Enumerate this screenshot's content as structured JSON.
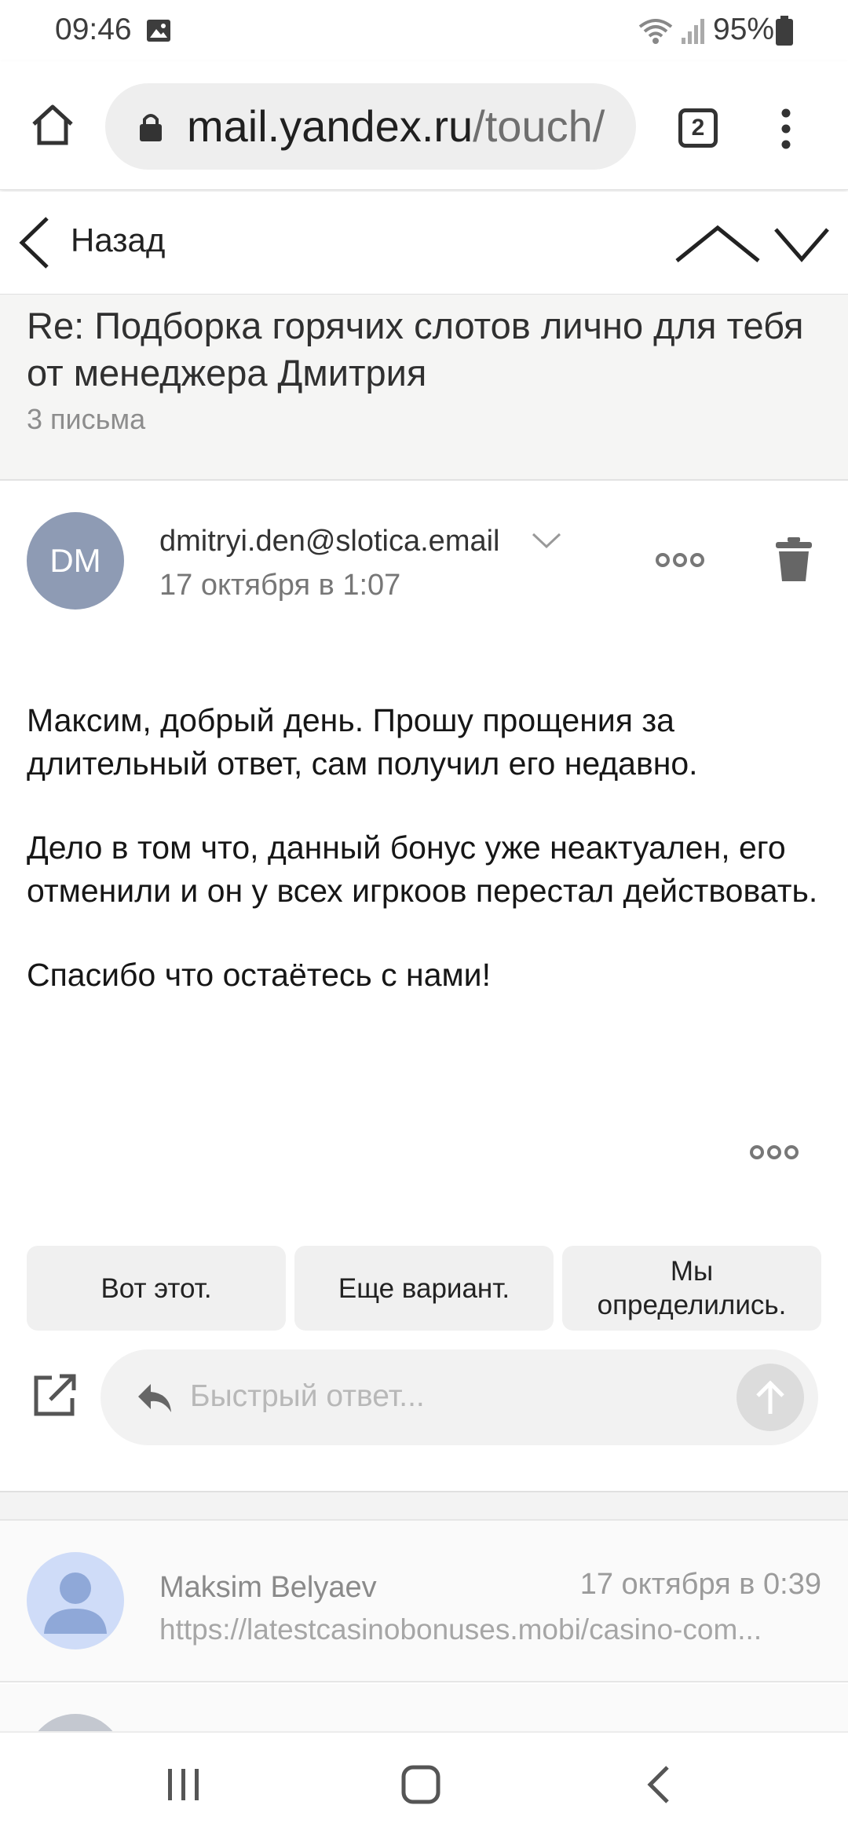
{
  "status_bar": {
    "time": "09:46",
    "battery": "95%"
  },
  "browser": {
    "url_domain": "mail.yandex.ru",
    "url_path": "/touch/",
    "tab_count": "2"
  },
  "mail_nav": {
    "back_label": "Назад"
  },
  "thread": {
    "subject": "Re: Подборка горячих слотов лично для тебя от менеджера Дмитрия",
    "count": "3 письма"
  },
  "message": {
    "avatar_initials": "DM",
    "sender": "dmitryi.den@slotica.email",
    "date": "17 октября в 1:07",
    "paragraphs": [
      "Максим, добрый день. Прошу прощения за длительный ответ, сам получил его недавно.",
      "Дело в том что, данный бонус уже неактуален, его отменили и он у всех игркоов перестал действовать.",
      "Спасибо что остаётесь с нами!"
    ]
  },
  "quick_replies": [
    "Вот этот.",
    "Еще вариант.",
    "Мы определились."
  ],
  "reply": {
    "placeholder": "Быстрый ответ..."
  },
  "previous_message": {
    "sender": "Maksim Belyaev",
    "date": "17 октября в 0:39",
    "snippet": "https://latestcasinobonuses.mobi/casino-com..."
  },
  "colors": {
    "avatar_dm": "#8e9bb4",
    "avatar_user": "#cfdcf8",
    "subject_bg": "#f5f5f4"
  }
}
